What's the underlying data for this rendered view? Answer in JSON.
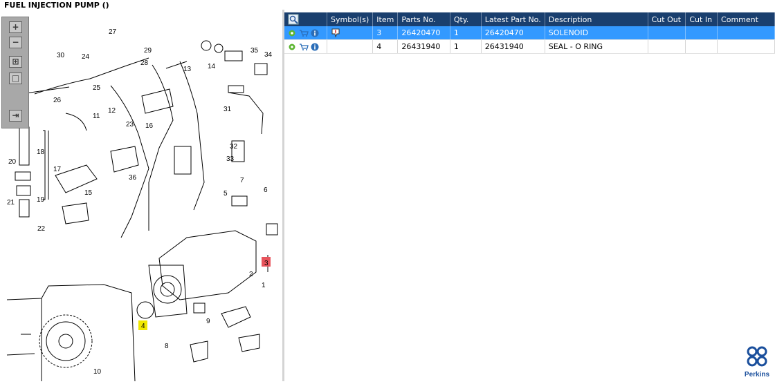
{
  "window": {
    "title": "FUEL INJECTION PUMP ()"
  },
  "toolbar": {
    "buttons": [
      {
        "name": "zoom-in-icon",
        "glyph": "+"
      },
      {
        "name": "zoom-out-icon",
        "glyph": "−"
      },
      {
        "name": "fit-all-icon",
        "glyph": "⊞"
      },
      {
        "name": "actual-size-icon",
        "glyph": "□"
      },
      {
        "name": "layout-toggle-icon",
        "glyph": "⇥"
      }
    ]
  },
  "diagram": {
    "callouts": [
      "1",
      "2",
      "3",
      "4",
      "5",
      "6",
      "7",
      "8",
      "9",
      "10",
      "11",
      "12",
      "13",
      "14",
      "15",
      "16",
      "17",
      "18",
      "19",
      "20",
      "21",
      "22",
      "23",
      "24",
      "25",
      "26",
      "27",
      "28",
      "29",
      "30",
      "31",
      "32",
      "33",
      "34",
      "35",
      "36"
    ]
  },
  "table": {
    "columns": [
      "Symbol(s)",
      "Item",
      "Parts No.",
      "Qty.",
      "Latest Part No.",
      "Description",
      "Cut Out",
      "Cut In",
      "Comment"
    ],
    "rows": [
      {
        "item": "3",
        "parts_no": "26420470",
        "qty": "1",
        "latest_part_no": "26420470",
        "description": "SOLENOID",
        "cut_out": "",
        "cut_in": "",
        "comment": "",
        "selected": true
      },
      {
        "item": "4",
        "parts_no": "26431940",
        "qty": "1",
        "latest_part_no": "26431940",
        "description": "SEAL - O RING",
        "cut_out": "",
        "cut_in": "",
        "comment": "",
        "selected": false
      }
    ]
  },
  "logo": {
    "text": "Perkins"
  },
  "colors": {
    "header": "#1a3f6e",
    "selected": "#3399ff",
    "brand": "#1a4f9c",
    "highlight_red": "#e8545c",
    "highlight_yellow": "#f0e800"
  }
}
